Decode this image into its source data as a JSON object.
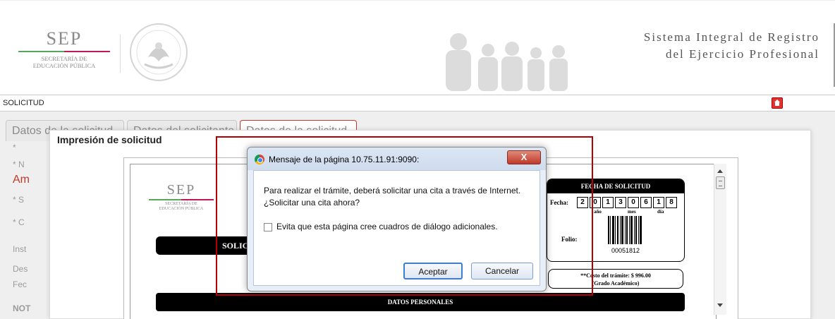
{
  "header": {
    "logo": {
      "name": "SEP",
      "subtitle_line1": "SECRETARÍA DE",
      "subtitle_line2": "EDUCACIÓN PÚBLICA"
    },
    "system_title_line1": "Sistema Integral de Registro",
    "system_title_line2": "del Ejercicio Profesional"
  },
  "solicitud_bar": {
    "label": "SOLICITUD",
    "home_icon": "home-icon"
  },
  "tabs": [
    {
      "label": "Datos de la solicitud"
    },
    {
      "label": "Datos del solicitante"
    },
    {
      "label": "Datos de la solicitud"
    }
  ],
  "left_items": [
    "*",
    "* N",
    "Am",
    "* S",
    "* C",
    "Inst",
    "Des",
    "Fec",
    "NOT"
  ],
  "panel": {
    "title": "Impresión de solicitud"
  },
  "document": {
    "sep": {
      "name": "SEP",
      "subtitle_line1": "SECRETARÍA DE",
      "subtitle_line2": "EDUCACIÓN PÚBLICA"
    },
    "solicitud_label": "SOLICI",
    "fecha_header": "FECHA DE SOLICITUD",
    "fecha_label": "Fecha:",
    "date_digits": [
      "2",
      "0",
      "1",
      "3",
      "0",
      "6",
      "1",
      "8"
    ],
    "year_label": "año",
    "month_label": "mes",
    "day_label": "día",
    "folio_label": "Folio:",
    "folio_number": "00051812",
    "costo_line1": "**Costo del trámite: $ 996.00",
    "costo_line2": "(Grado Académico)",
    "datos_personales": "DATOS PERSONALES"
  },
  "dialog": {
    "title": "Mensaje de la página 10.75.11.91:9090:",
    "close_label": "X",
    "message": "Para realizar el trámite, deberá solicitar una cita a través de Internet. ¿Solicitar una cita ahora?",
    "checkbox_label": "Evita que esta página cree cuadros de diálogo adicionales.",
    "checkbox_checked": false,
    "ok_label": "Aceptar",
    "cancel_label": "Cancelar"
  },
  "colors": {
    "highlight": "#b30000",
    "tab_active_border": "#c0392b",
    "dialog_close": "#c0392b"
  }
}
